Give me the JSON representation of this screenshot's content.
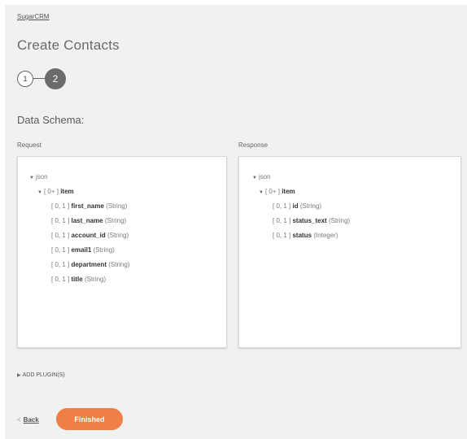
{
  "breadcrumb": "SugarCRM",
  "page_title": "Create Contacts",
  "steps": [
    "1",
    "2"
  ],
  "schema_title": "Data Schema:",
  "request": {
    "label": "Request",
    "root": "json",
    "item_card": "[ 0+ ]",
    "item_name": "item",
    "fields": [
      {
        "card": "[ 0, 1 ]",
        "name": "first_name",
        "type": "(String)"
      },
      {
        "card": "[ 0, 1 ]",
        "name": "last_name",
        "type": "(String)"
      },
      {
        "card": "[ 0, 1 ]",
        "name": "account_id",
        "type": "(String)"
      },
      {
        "card": "[ 0, 1 ]",
        "name": "email1",
        "type": "(String)"
      },
      {
        "card": "[ 0, 1 ]",
        "name": "department",
        "type": "(String)"
      },
      {
        "card": "[ 0, 1 ]",
        "name": "title",
        "type": "(String)"
      }
    ]
  },
  "response": {
    "label": "Response",
    "root": "json",
    "item_card": "[ 0+ ]",
    "item_name": "item",
    "fields": [
      {
        "card": "[ 0, 1 ]",
        "name": "id",
        "type": "(String)"
      },
      {
        "card": "[ 0, 1 ]",
        "name": "status_text",
        "type": "(String)"
      },
      {
        "card": "[ 0, 1 ]",
        "name": "status",
        "type": "(Integer)"
      }
    ]
  },
  "add_plugins": "ADD PLUGIN(S)",
  "back_label": "Back",
  "finished_label": "Finished",
  "colors": {
    "accent": "#f07f45",
    "step_active": "#6b6b6b",
    "panel_bg": "#f1f1f1"
  },
  "icons": {
    "expand": "triangle-down-icon",
    "collapsed": "triangle-right-icon",
    "back": "chevron-left-icon"
  }
}
